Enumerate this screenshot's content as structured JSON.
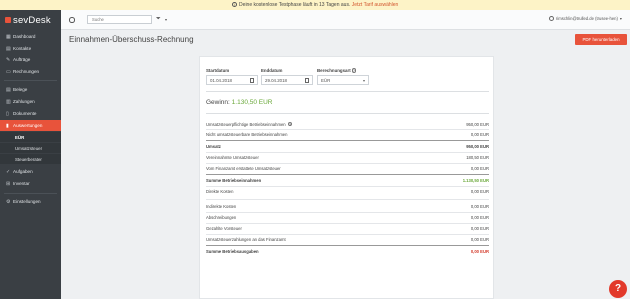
{
  "banner": {
    "text": "Deine kostenlose Testphase läuft in 13 Tagen aus.",
    "link": "Jetzt Tarif auswählen"
  },
  "logo": {
    "text": "sevDesk"
  },
  "sidebar": {
    "items": [
      {
        "label": "Dashboard",
        "icon": "dashboard-icon"
      },
      {
        "label": "Kontakte",
        "icon": "contacts-icon"
      },
      {
        "label": "Aufträge",
        "icon": "orders-icon"
      },
      {
        "label": "Rechnungen",
        "icon": "invoice-icon"
      },
      {
        "label": "Belege",
        "icon": "receipt-icon"
      },
      {
        "label": "Zahlungen",
        "icon": "payments-icon"
      },
      {
        "label": "Dokumente",
        "icon": "documents-icon"
      },
      {
        "label": "Auswertungen",
        "icon": "reports-icon"
      },
      {
        "label": "Aufgaben",
        "icon": "tasks-icon"
      },
      {
        "label": "Inventar",
        "icon": "inventory-icon"
      },
      {
        "label": "Einstellungen",
        "icon": "settings-icon"
      }
    ],
    "subitems": [
      {
        "label": "EÜR"
      },
      {
        "label": "Umsatzsteuer"
      },
      {
        "label": "Steuerberater"
      }
    ]
  },
  "topbar": {
    "search_placeholder": "Suche",
    "user": "rimschlin@trulled.de (trusee-hen)"
  },
  "page": {
    "title": "Einnahmen-Überschuss-Rechnung",
    "pdf_button": "PDF herunterladen"
  },
  "filters": {
    "start_label": "Startdatum",
    "start_value": "01.04.2018",
    "end_label": "Enddatum",
    "end_value": "29.04.2018",
    "basis_label": "Berechnungsart",
    "basis_value": "EÜR"
  },
  "result": {
    "label": "Gewinn:",
    "value": "1.130,50 EUR"
  },
  "rows": [
    {
      "label": "Umsatzsteuerpflichtige Betriebseinnahmen",
      "value": "950,00 EUR"
    },
    {
      "label": "Nicht umsatzsteuerbare Betriebseinnahmen",
      "value": "0,00 EUR"
    },
    {
      "label": "Umsatz",
      "value": "950,00 EUR"
    },
    {
      "label": "Vereinnahmte Umsatzsteuer",
      "value": "180,50 EUR"
    },
    {
      "label": "Vom Finanzamt erstattete Umsatzsteuer",
      "value": "0,00 EUR"
    },
    {
      "label": "Summe Betriebseinnahmen",
      "value": "1.130,50 EUR"
    },
    {
      "label": "Direkte Kosten",
      "value": "0,00 EUR"
    },
    {
      "label": "Indirekte Kosten",
      "value": "0,00 EUR"
    },
    {
      "label": "Abschreibungen",
      "value": "0,00 EUR"
    },
    {
      "label": "Gezahlte Vorsteuer",
      "value": "0,00 EUR"
    },
    {
      "label": "Umsatzsteuerzahlungen an das Finanzamt",
      "value": "0,00 EUR"
    },
    {
      "label": "Summe Betriebsausgaben",
      "value": "0,00 EUR"
    }
  ],
  "help_fab": "?",
  "colors": {
    "accent": "#e8533b",
    "sidebar": "#3a3f44",
    "positive": "#6aa83a",
    "negative": "#d33b2c"
  }
}
